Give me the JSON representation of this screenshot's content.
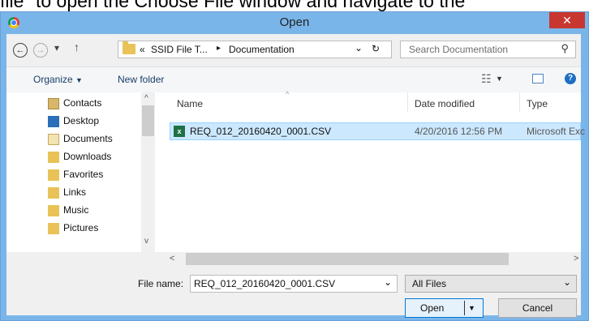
{
  "background_text": "file\" to open the Choose File window and navigate to the",
  "window": {
    "title": "Open",
    "close_glyph": "✕"
  },
  "address_bar": {
    "back_glyph": "←",
    "forward_glyph": "→",
    "dropdown_glyph": "▾",
    "up_glyph": "↑",
    "prefix": "«",
    "crumb_parent": "SSID File T...",
    "separator": "▸",
    "crumb_current": "Documentation",
    "chevron": "⌄",
    "refresh_glyph": "↻"
  },
  "search": {
    "placeholder": "Search Documentation",
    "icon_glyph": "⚲"
  },
  "toolbar": {
    "organize_label": "Organize",
    "organize_glyph": "▼",
    "new_folder_label": "New folder",
    "view_glyph": "☷",
    "view_dropdown_glyph": "▼",
    "help_glyph": "?"
  },
  "nav": {
    "items": [
      {
        "label": "Contacts",
        "icon": "contacts-icon"
      },
      {
        "label": "Desktop",
        "icon": "desktop-icon"
      },
      {
        "label": "Documents",
        "icon": "documents-icon"
      },
      {
        "label": "Downloads",
        "icon": "downloads-icon"
      },
      {
        "label": "Favorites",
        "icon": "favorites-icon"
      },
      {
        "label": "Links",
        "icon": "links-icon"
      },
      {
        "label": "Music",
        "icon": "music-icon"
      },
      {
        "label": "Pictures",
        "icon": "pictures-icon"
      }
    ],
    "scroll_up": "^",
    "scroll_down": "v"
  },
  "files": {
    "columns": {
      "name": "Name",
      "date": "Date modified",
      "type": "Type",
      "sort_glyph": "^"
    },
    "rows": [
      {
        "name": "REQ_012_20160420_0001.CSV",
        "date": "4/20/2016 12:56 PM",
        "type": "Microsoft Exc",
        "selected": true
      }
    ],
    "excel_badge": "x"
  },
  "hscroll": {
    "left": "<",
    "right": ">"
  },
  "bottom": {
    "filename_label": "File name:",
    "filename_value": "REQ_012_20160420_0001.CSV",
    "filename_chevron": "⌄",
    "filter_value": "All Files",
    "filter_chevron": "⌄",
    "open_label": "Open",
    "open_split_glyph": "▼",
    "cancel_label": "Cancel"
  },
  "colors": {
    "title_bar": "#7ab5ea",
    "close_button": "#c7372f",
    "selection": "#cce8ff",
    "excel_green": "#1e7145"
  }
}
